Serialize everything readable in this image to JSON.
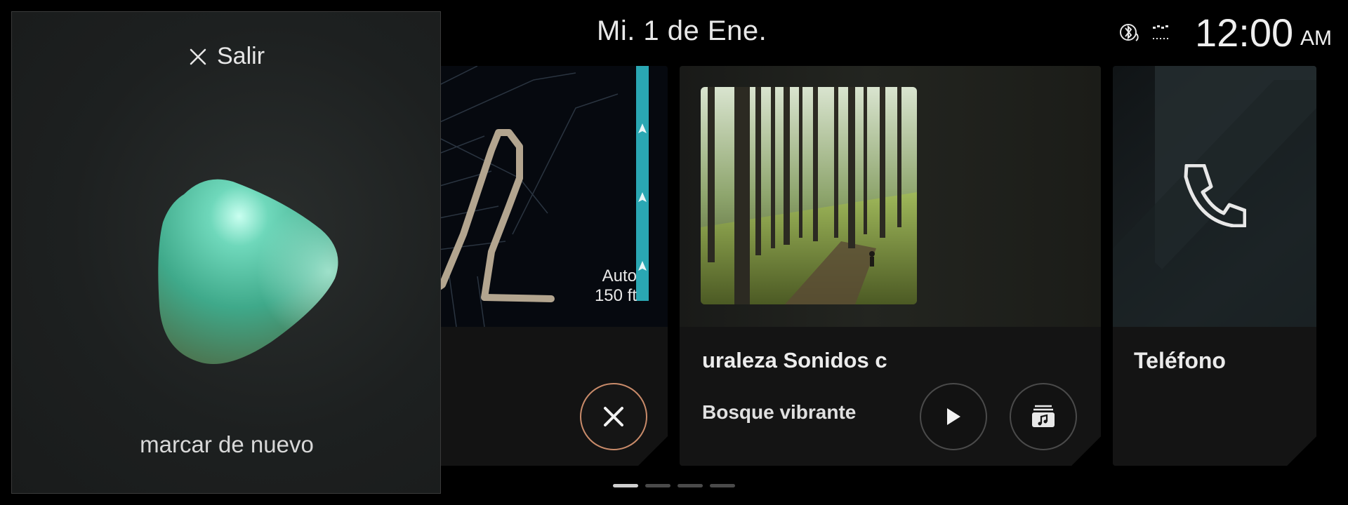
{
  "status_bar": {
    "date": "Mi. 1 de Ene.",
    "time": "12:00",
    "ampm": "AM",
    "icons": [
      "bluetooth-audio-icon",
      "signal-icon"
    ]
  },
  "navigation": {
    "distance_mode": "Auto",
    "distance": "150 ft",
    "cancel_icon": "close-icon"
  },
  "media": {
    "title_scroll": "uraleza   Sonidos c",
    "track": "Bosque vibrante",
    "play_icon": "play-icon",
    "library_icon": "music-library-icon"
  },
  "phone": {
    "label": "Teléfono",
    "icon": "phone-icon"
  },
  "voice_assistant": {
    "exit_label": "Salir",
    "hint": "marcar de nuevo"
  },
  "pagination": {
    "total": 4,
    "active": 1
  },
  "colors": {
    "route_active": "#2aa7b3",
    "route_past": "#b3a58f",
    "cancel_ring": "#c98b6a",
    "blob": "#3fb39a"
  }
}
